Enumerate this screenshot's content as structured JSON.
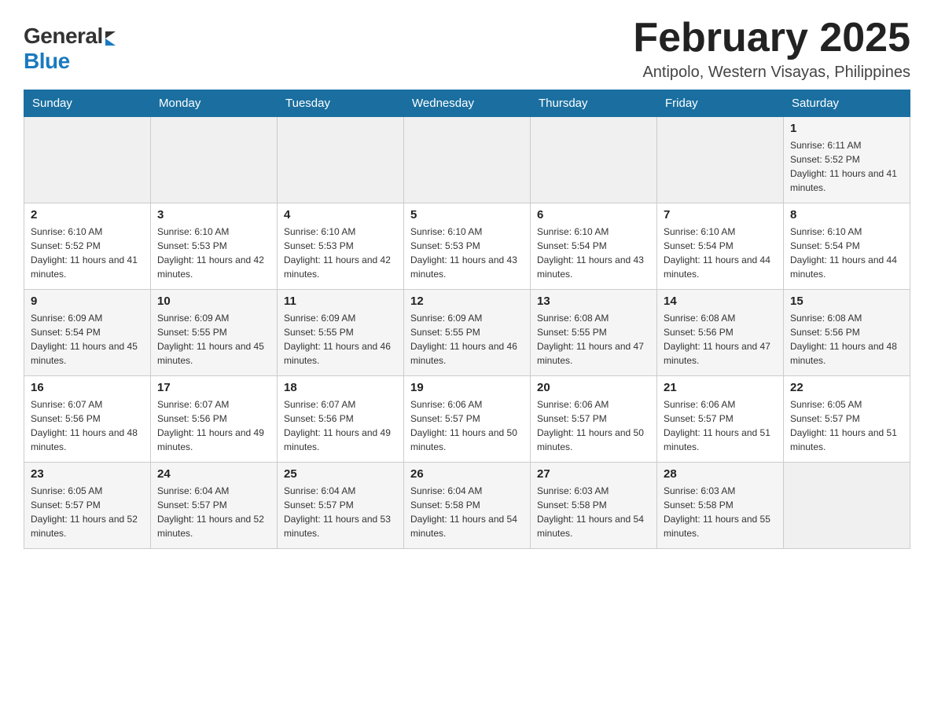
{
  "header": {
    "logo_general": "General",
    "logo_blue": "Blue",
    "month_year": "February 2025",
    "location": "Antipolo, Western Visayas, Philippines"
  },
  "days_of_week": [
    "Sunday",
    "Monday",
    "Tuesday",
    "Wednesday",
    "Thursday",
    "Friday",
    "Saturday"
  ],
  "weeks": [
    [
      {
        "day": "",
        "info": ""
      },
      {
        "day": "",
        "info": ""
      },
      {
        "day": "",
        "info": ""
      },
      {
        "day": "",
        "info": ""
      },
      {
        "day": "",
        "info": ""
      },
      {
        "day": "",
        "info": ""
      },
      {
        "day": "1",
        "info": "Sunrise: 6:11 AM\nSunset: 5:52 PM\nDaylight: 11 hours and 41 minutes."
      }
    ],
    [
      {
        "day": "2",
        "info": "Sunrise: 6:10 AM\nSunset: 5:52 PM\nDaylight: 11 hours and 41 minutes."
      },
      {
        "day": "3",
        "info": "Sunrise: 6:10 AM\nSunset: 5:53 PM\nDaylight: 11 hours and 42 minutes."
      },
      {
        "day": "4",
        "info": "Sunrise: 6:10 AM\nSunset: 5:53 PM\nDaylight: 11 hours and 42 minutes."
      },
      {
        "day": "5",
        "info": "Sunrise: 6:10 AM\nSunset: 5:53 PM\nDaylight: 11 hours and 43 minutes."
      },
      {
        "day": "6",
        "info": "Sunrise: 6:10 AM\nSunset: 5:54 PM\nDaylight: 11 hours and 43 minutes."
      },
      {
        "day": "7",
        "info": "Sunrise: 6:10 AM\nSunset: 5:54 PM\nDaylight: 11 hours and 44 minutes."
      },
      {
        "day": "8",
        "info": "Sunrise: 6:10 AM\nSunset: 5:54 PM\nDaylight: 11 hours and 44 minutes."
      }
    ],
    [
      {
        "day": "9",
        "info": "Sunrise: 6:09 AM\nSunset: 5:54 PM\nDaylight: 11 hours and 45 minutes."
      },
      {
        "day": "10",
        "info": "Sunrise: 6:09 AM\nSunset: 5:55 PM\nDaylight: 11 hours and 45 minutes."
      },
      {
        "day": "11",
        "info": "Sunrise: 6:09 AM\nSunset: 5:55 PM\nDaylight: 11 hours and 46 minutes."
      },
      {
        "day": "12",
        "info": "Sunrise: 6:09 AM\nSunset: 5:55 PM\nDaylight: 11 hours and 46 minutes."
      },
      {
        "day": "13",
        "info": "Sunrise: 6:08 AM\nSunset: 5:55 PM\nDaylight: 11 hours and 47 minutes."
      },
      {
        "day": "14",
        "info": "Sunrise: 6:08 AM\nSunset: 5:56 PM\nDaylight: 11 hours and 47 minutes."
      },
      {
        "day": "15",
        "info": "Sunrise: 6:08 AM\nSunset: 5:56 PM\nDaylight: 11 hours and 48 minutes."
      }
    ],
    [
      {
        "day": "16",
        "info": "Sunrise: 6:07 AM\nSunset: 5:56 PM\nDaylight: 11 hours and 48 minutes."
      },
      {
        "day": "17",
        "info": "Sunrise: 6:07 AM\nSunset: 5:56 PM\nDaylight: 11 hours and 49 minutes."
      },
      {
        "day": "18",
        "info": "Sunrise: 6:07 AM\nSunset: 5:56 PM\nDaylight: 11 hours and 49 minutes."
      },
      {
        "day": "19",
        "info": "Sunrise: 6:06 AM\nSunset: 5:57 PM\nDaylight: 11 hours and 50 minutes."
      },
      {
        "day": "20",
        "info": "Sunrise: 6:06 AM\nSunset: 5:57 PM\nDaylight: 11 hours and 50 minutes."
      },
      {
        "day": "21",
        "info": "Sunrise: 6:06 AM\nSunset: 5:57 PM\nDaylight: 11 hours and 51 minutes."
      },
      {
        "day": "22",
        "info": "Sunrise: 6:05 AM\nSunset: 5:57 PM\nDaylight: 11 hours and 51 minutes."
      }
    ],
    [
      {
        "day": "23",
        "info": "Sunrise: 6:05 AM\nSunset: 5:57 PM\nDaylight: 11 hours and 52 minutes."
      },
      {
        "day": "24",
        "info": "Sunrise: 6:04 AM\nSunset: 5:57 PM\nDaylight: 11 hours and 52 minutes."
      },
      {
        "day": "25",
        "info": "Sunrise: 6:04 AM\nSunset: 5:57 PM\nDaylight: 11 hours and 53 minutes."
      },
      {
        "day": "26",
        "info": "Sunrise: 6:04 AM\nSunset: 5:58 PM\nDaylight: 11 hours and 54 minutes."
      },
      {
        "day": "27",
        "info": "Sunrise: 6:03 AM\nSunset: 5:58 PM\nDaylight: 11 hours and 54 minutes."
      },
      {
        "day": "28",
        "info": "Sunrise: 6:03 AM\nSunset: 5:58 PM\nDaylight: 11 hours and 55 minutes."
      },
      {
        "day": "",
        "info": ""
      }
    ]
  ],
  "colors": {
    "header_bg": "#1a6fa0",
    "header_text": "#ffffff",
    "accent_blue": "#1a7abf"
  }
}
